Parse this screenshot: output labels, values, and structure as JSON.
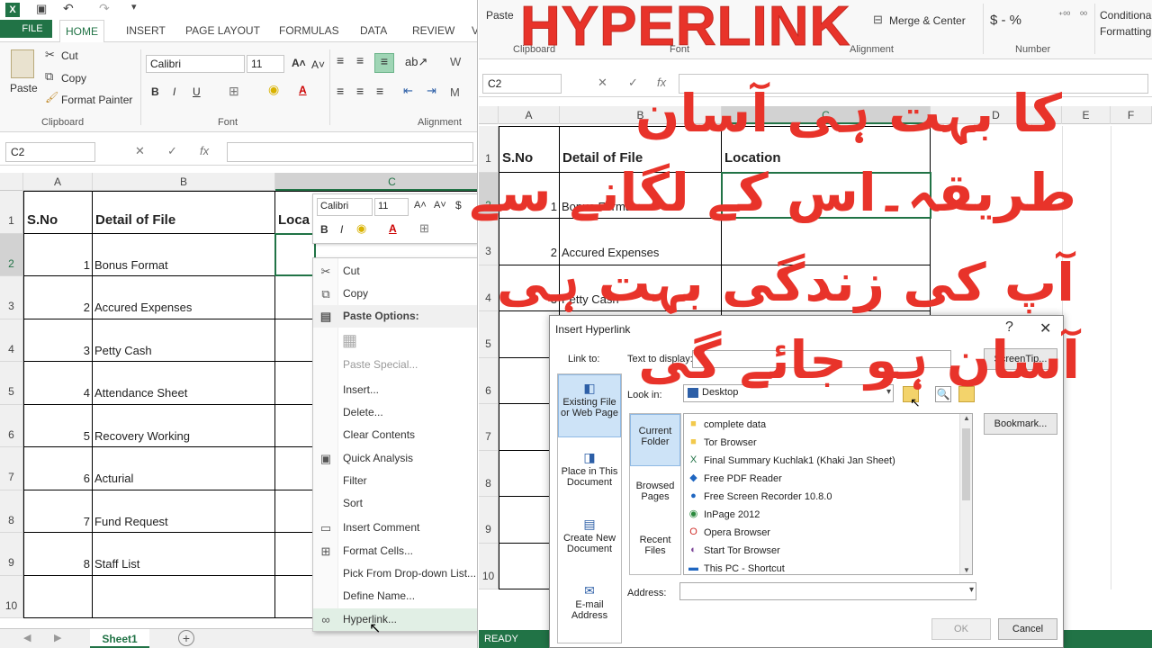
{
  "left": {
    "tabs": [
      "FILE",
      "HOME",
      "INSERT",
      "PAGE LAYOUT",
      "FORMULAS",
      "DATA",
      "REVIEW",
      "V"
    ],
    "clipboard": {
      "paste": "Paste",
      "cut": "Cut",
      "copy": "Copy",
      "format_painter": "Format Painter",
      "label": "Clipboard"
    },
    "font": {
      "name": "Calibri",
      "size": "11",
      "label": "Font"
    },
    "alignment": {
      "label": "Alignment"
    },
    "name_box": "C2",
    "col_headers": [
      "A",
      "B",
      "C"
    ],
    "row_numbers": [
      "1",
      "2",
      "3",
      "4",
      "5",
      "6",
      "7",
      "8",
      "9",
      "10"
    ],
    "table_headers": [
      "S.No",
      "Detail of File",
      "Loca"
    ],
    "rows": [
      {
        "n": "1",
        "d": "Bonus Format"
      },
      {
        "n": "2",
        "d": "Accured Expenses"
      },
      {
        "n": "3",
        "d": "Petty Cash"
      },
      {
        "n": "4",
        "d": "Attendance Sheet"
      },
      {
        "n": "5",
        "d": "Recovery Working"
      },
      {
        "n": "6",
        "d": "Acturial"
      },
      {
        "n": "7",
        "d": "Fund Request"
      },
      {
        "n": "8",
        "d": "Staff List"
      }
    ],
    "sheet_tab": "Sheet1",
    "mini_toolbar": {
      "font": "Calibri",
      "size": "11"
    },
    "context_menu": [
      {
        "label": "Cut",
        "icon": "scissors-icon",
        "disabled": false
      },
      {
        "label": "Copy",
        "icon": "copy-icon",
        "disabled": false
      },
      {
        "label": "Paste Options:",
        "icon": "paste-icon",
        "header": true
      },
      {
        "label": "",
        "icon": "clipboard-icon",
        "disabled": true
      },
      {
        "label": "Paste Special...",
        "icon": "",
        "disabled": true
      },
      {
        "label": "Insert...",
        "icon": "",
        "disabled": false
      },
      {
        "label": "Delete...",
        "icon": "",
        "disabled": false
      },
      {
        "label": "Clear Contents",
        "icon": "",
        "disabled": false
      },
      {
        "label": "Quick Analysis",
        "icon": "quick-analysis-icon",
        "disabled": false
      },
      {
        "label": "Filter",
        "icon": "",
        "disabled": false
      },
      {
        "label": "Sort",
        "icon": "",
        "disabled": false
      },
      {
        "label": "Insert Comment",
        "icon": "comment-icon",
        "disabled": false
      },
      {
        "label": "Format Cells...",
        "icon": "format-cells-icon",
        "disabled": false
      },
      {
        "label": "Pick From Drop-down List...",
        "icon": "",
        "disabled": false
      },
      {
        "label": "Define Name...",
        "icon": "",
        "disabled": false
      },
      {
        "label": "Hyperlink...",
        "icon": "hyperlink-icon",
        "disabled": false,
        "highlight": true
      }
    ]
  },
  "right": {
    "ribbon": {
      "paste": "Paste",
      "clipboard": "Clipboard",
      "font": "Font",
      "alignment": "Alignment",
      "merge_center": "Merge & Center",
      "number": "Number",
      "number_format": "$ - %",
      "conditional": "Conditional",
      "formatting": "Formatting"
    },
    "name_box": "C2",
    "col_headers": [
      "A",
      "B",
      "C",
      "D",
      "E",
      "F"
    ],
    "row_numbers": [
      "1",
      "2",
      "3",
      "4",
      "5",
      "6",
      "7",
      "8",
      "9",
      "10"
    ],
    "table_headers": [
      "S.No",
      "Detail of File",
      "Location"
    ],
    "rows": [
      {
        "n": "1",
        "d": "Bonus Format"
      },
      {
        "n": "2",
        "d": "Accured Expenses"
      },
      {
        "n": "3",
        "d": "Petty Cash"
      }
    ],
    "status": "READY"
  },
  "dialog": {
    "title": "Insert Hyperlink",
    "help": "?",
    "close": "✕",
    "link_to_label": "Link to:",
    "link_to": [
      "Existing File or Web Page",
      "Place in This Document",
      "Create New Document",
      "E-mail Address"
    ],
    "text_to_display_label": "Text to display:",
    "screentip": "ScreenTip...",
    "look_in_label": "Look in:",
    "look_in_value": "Desktop",
    "side_tabs": [
      "Current Folder",
      "Browsed Pages",
      "Recent Files"
    ],
    "files": [
      {
        "name": "complete data",
        "icon": "folder-icon",
        "color": "#f2c94c"
      },
      {
        "name": "Tor Browser",
        "icon": "folder-icon",
        "color": "#f2c94c"
      },
      {
        "name": "Final Summary Kuchlak1 (Khaki Jan Sheet)",
        "icon": "excel-file-icon",
        "color": "#217346"
      },
      {
        "name": "Free PDF Reader",
        "icon": "pdf-icon",
        "color": "#1f66c1"
      },
      {
        "name": "Free Screen Recorder 10.8.0",
        "icon": "recorder-icon",
        "color": "#1f66c1"
      },
      {
        "name": "InPage 2012",
        "icon": "inpage-icon",
        "color": "#2b8a3e"
      },
      {
        "name": "Opera Browser",
        "icon": "opera-icon",
        "color": "#d0302b"
      },
      {
        "name": "Start Tor Browser",
        "icon": "tor-icon",
        "color": "#7d4698"
      },
      {
        "name": "This PC - Shortcut",
        "icon": "pc-icon",
        "color": "#1f66c1"
      }
    ],
    "bookmark": "Bookmark...",
    "address_label": "Address:",
    "ok": "OK",
    "cancel": "Cancel"
  },
  "overlay": {
    "banner": "HYPERLINK",
    "urdu_lines": [
      "کا بہت ہی آسان",
      "طریقہ۔اس کے لگانے سے",
      "آپ کی زندگی بہت ہی",
      "آسان ہو جائے گی"
    ]
  },
  "colors": {
    "excel_green": "#217346",
    "overlay_red": "#e8332a"
  }
}
